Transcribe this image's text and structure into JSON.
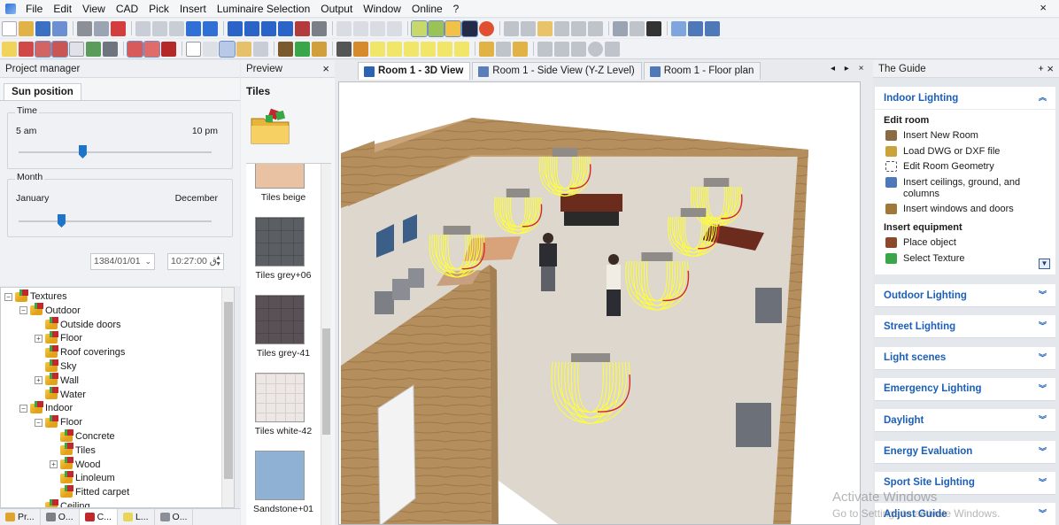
{
  "menubar": {
    "items": [
      "File",
      "Edit",
      "View",
      "CAD",
      "Pick",
      "Insert",
      "Luminaire Selection",
      "Output",
      "Window",
      "Online",
      "?"
    ],
    "close_glyph": "×"
  },
  "project_manager": {
    "title": "Project manager",
    "tab_label": "Sun position",
    "time": {
      "group_label": "Time",
      "min_label": "5 am",
      "max_label": "10 pm",
      "value_fraction": 0.33
    },
    "month": {
      "group_label": "Month",
      "min_label": "January",
      "max_label": "December",
      "value_fraction": 0.22
    },
    "date_value": "1384/01/01",
    "time_value": "10:27:00 ق"
  },
  "tree": {
    "items": [
      {
        "label": "Textures",
        "expander": "−"
      },
      {
        "label": "Outdoor",
        "expander": "−"
      },
      {
        "label": "Outside doors",
        "expander": ""
      },
      {
        "label": "Floor",
        "expander": "+"
      },
      {
        "label": "Roof coverings",
        "expander": ""
      },
      {
        "label": "Sky",
        "expander": ""
      },
      {
        "label": "Wall",
        "expander": "+"
      },
      {
        "label": "Water",
        "expander": ""
      },
      {
        "label": "Indoor",
        "expander": "−"
      },
      {
        "label": "Floor",
        "expander": "−"
      },
      {
        "label": "Concrete",
        "expander": ""
      },
      {
        "label": "Tiles",
        "expander": ""
      },
      {
        "label": "Wood",
        "expander": "+"
      },
      {
        "label": "Linoleum",
        "expander": ""
      },
      {
        "label": "Fitted carpet",
        "expander": ""
      },
      {
        "label": "Ceiling",
        "expander": ""
      }
    ]
  },
  "bottom_tabs": [
    "Pr...",
    "O...",
    "C...",
    "L...",
    "O..."
  ],
  "preview": {
    "title": "Preview",
    "close_glyph": "×",
    "folder_title": "Tiles",
    "items": [
      {
        "label": "Tiles beige",
        "color": "#e9c2a3"
      },
      {
        "label": "Tiles grey+06",
        "color": "#5b5e63"
      },
      {
        "label": "Tiles grey-41",
        "color": "#5a5156"
      },
      {
        "label": "Tiles white-42",
        "color": "#ece6e4"
      },
      {
        "label": "Sandstone+01",
        "color": "#8fb2d4"
      }
    ]
  },
  "view_tabs": [
    {
      "label": "Room 1 - 3D View",
      "active": true
    },
    {
      "label": "Room 1 - Side View (Y-Z Level)",
      "active": false
    },
    {
      "label": "Room 1 - Floor plan",
      "active": false
    }
  ],
  "view_nav": "◂ ▸ ×",
  "guide": {
    "title": "The Guide",
    "pin_glyph": "ᚐ",
    "close_glyph": "×",
    "open_section": {
      "label": "Indoor Lighting",
      "subsections": [
        {
          "label": "Edit room",
          "links": [
            "Insert New Room",
            "Load DWG or DXF file",
            "Edit Room Geometry",
            "Insert ceilings, ground, and columns",
            "Insert windows and doors"
          ]
        },
        {
          "label": "Insert equipment",
          "links": [
            "Place object",
            "Select Texture"
          ]
        }
      ]
    },
    "sections": [
      "Outdoor Lighting",
      "Street Lighting",
      "Light scenes",
      "Emergency Lighting",
      "Daylight",
      "Energy Evaluation",
      "Sport Site Lighting",
      "Adjust Guide"
    ]
  },
  "watermark": {
    "line1": "Activate Windows",
    "line2": "Go to Settings to activate Windows."
  },
  "colors": {
    "accent": "#1c5fb8",
    "slider": "#1f73c9",
    "luminaire_lines": "#ffff33"
  }
}
